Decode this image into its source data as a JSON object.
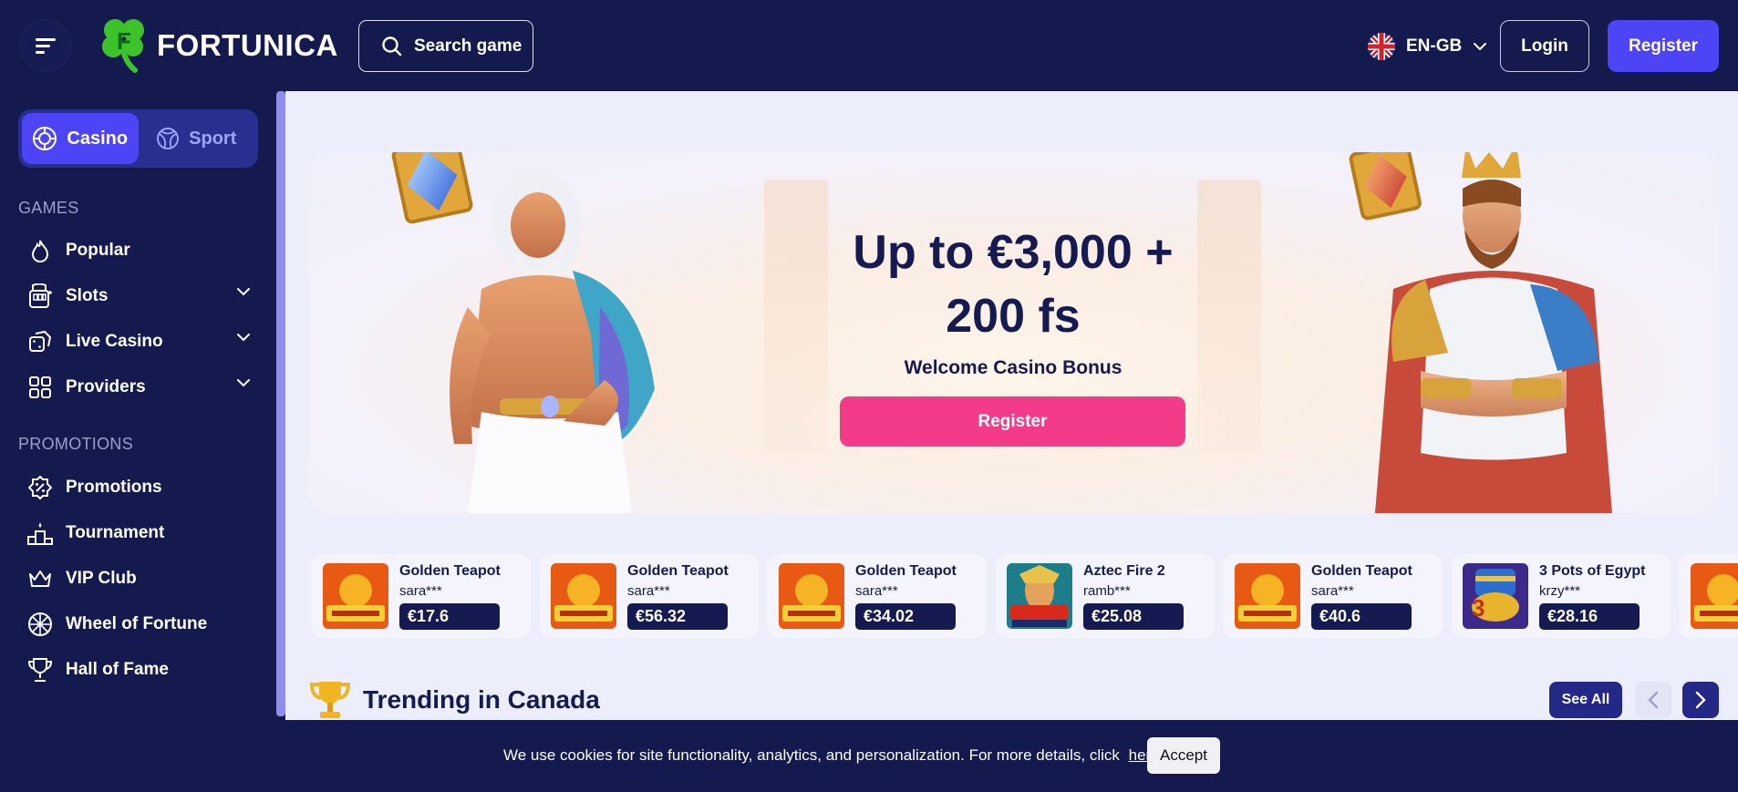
{
  "header": {
    "brand": "FORTUNICA",
    "search_label": "Search game",
    "language": "EN-GB",
    "login_label": "Login",
    "register_label": "Register"
  },
  "sidebar": {
    "modes": [
      {
        "label": "Casino",
        "icon": "casino-chip-icon",
        "active": true
      },
      {
        "label": "Sport",
        "icon": "ball-icon",
        "active": false
      }
    ],
    "games_heading": "GAMES",
    "games": [
      {
        "label": "Popular",
        "icon": "flame-icon"
      },
      {
        "label": "Slots",
        "icon": "slot-machine-icon",
        "expandable": true
      },
      {
        "label": "Live Casino",
        "icon": "dice-icon",
        "expandable": true
      },
      {
        "label": "Providers",
        "icon": "grid-icon",
        "expandable": true
      }
    ],
    "promotions_heading": "PROMOTIONS",
    "promotions": [
      {
        "label": "Promotions",
        "icon": "percent-badge-icon"
      },
      {
        "label": "Tournament",
        "icon": "podium-icon"
      },
      {
        "label": "VIP Club",
        "icon": "crown-icon"
      },
      {
        "label": "Wheel of Fortune",
        "icon": "wheel-icon"
      },
      {
        "label": "Hall of Fame",
        "icon": "trophy-icon"
      }
    ]
  },
  "hero": {
    "title_line1": "Up to €3,000 +",
    "title_line2": "200 fs",
    "subtitle": "Welcome Casino Bonus",
    "cta_label": "Register"
  },
  "winners": [
    {
      "game": "Golden Teapot",
      "user": "sara***",
      "amount": "€17.6"
    },
    {
      "game": "Golden Teapot",
      "user": "sara***",
      "amount": "€56.32"
    },
    {
      "game": "Golden Teapot",
      "user": "sara***",
      "amount": "€34.02"
    },
    {
      "game": "Aztec Fire 2",
      "user": "ramb***",
      "amount": "€25.08"
    },
    {
      "game": "Golden Teapot",
      "user": "sara***",
      "amount": "€40.6"
    },
    {
      "game": "3 Pots of Egypt",
      "user": "krzy***",
      "amount": "€28.16"
    }
  ],
  "trending": {
    "title": "Trending in Canada",
    "see_all_label": "See All"
  },
  "cookie": {
    "text": "We use cookies for site functionality, analytics, and personalization. For more details, click",
    "link_label": "here",
    "accept_label": "Accept"
  },
  "colors": {
    "navy": "#141a4e",
    "accent": "#4d45f5",
    "pink": "#f43b8a",
    "logo_green": "#3ec22b"
  }
}
